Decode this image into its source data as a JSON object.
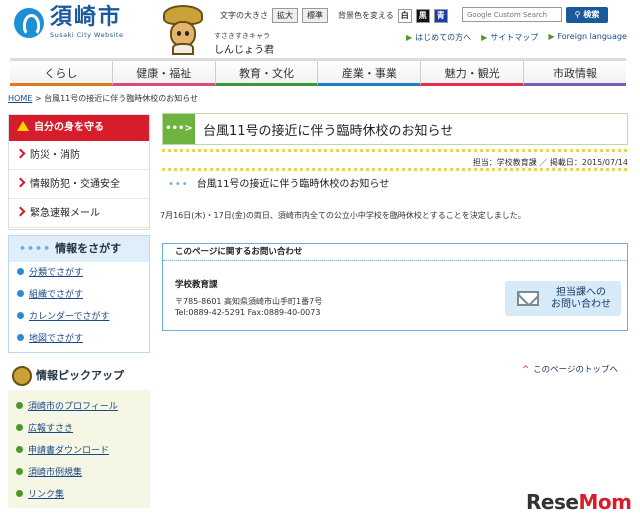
{
  "header": {
    "logo_name": "須崎市",
    "logo_sub": "Susaki City Website",
    "mascot_caption": "すさきすきキャラ",
    "mascot_name": "しんじょう君",
    "text_size_label": "文字の大きさ",
    "text_size_large": "拡大",
    "text_size_std": "標準",
    "bg_color_label": "背景色を変える",
    "bg_white": "白",
    "bg_black": "黒",
    "bg_blue": "青",
    "search_placeholder": "Google Custom Search",
    "search_button": "検索",
    "links": [
      "はじめての方へ",
      "サイトマップ",
      "Foreign language"
    ]
  },
  "gnav": [
    "くらし",
    "健康・福祉",
    "教育・文化",
    "産業・事業",
    "魅力・観光",
    "市政情報"
  ],
  "breadcrumb": {
    "home": "HOME",
    "sep": " > ",
    "current": "台風11号の接近に伴う臨時休校のお知らせ"
  },
  "sidebar": {
    "protect_title": "自分の身を守る",
    "protect_items": [
      "防災・消防",
      "情報防犯・交通安全",
      "緊急速報メール"
    ],
    "find_title": "情報をさがす",
    "find_dots": "••••",
    "find_items": [
      "分類でさがす",
      "組織でさがす",
      "カレンダーでさがす",
      "地図でさがす"
    ],
    "pickup_title": "情報ピックアップ",
    "pickup_items": [
      "須崎市のプロフィール",
      "広報すさき",
      "申請書ダウンロード",
      "須崎市例規集",
      "リンク集"
    ]
  },
  "main": {
    "title_arrow": "•••>",
    "title": "台風11号の接近に伴う臨時休校のお知らせ",
    "meta": "担当：学校教育課 ／ 掲載日：2015/07/14",
    "subtitle": "台風11号の接近に伴う臨時休校のお知らせ",
    "sub_dots": "•••",
    "body": "7月16日(木)・17日(金)の両日、須崎市内全ての公立小中学校を臨時休校とすることを決定しました。",
    "contact_title": "このページに関するお問い合わせ",
    "dept": "学校教育課",
    "address": "〒785-8601 高知県須崎市山手町1番7号",
    "tel": "Tel:0889-42-5291 Fax:0889-40-0073",
    "mail_line1": "担当課への",
    "mail_line2": "お問い合わせ",
    "to_top": "このページのトップへ",
    "to_top_arrow": "^"
  },
  "watermark": {
    "brand_a": "Rese",
    "brand_b": "Mom"
  }
}
